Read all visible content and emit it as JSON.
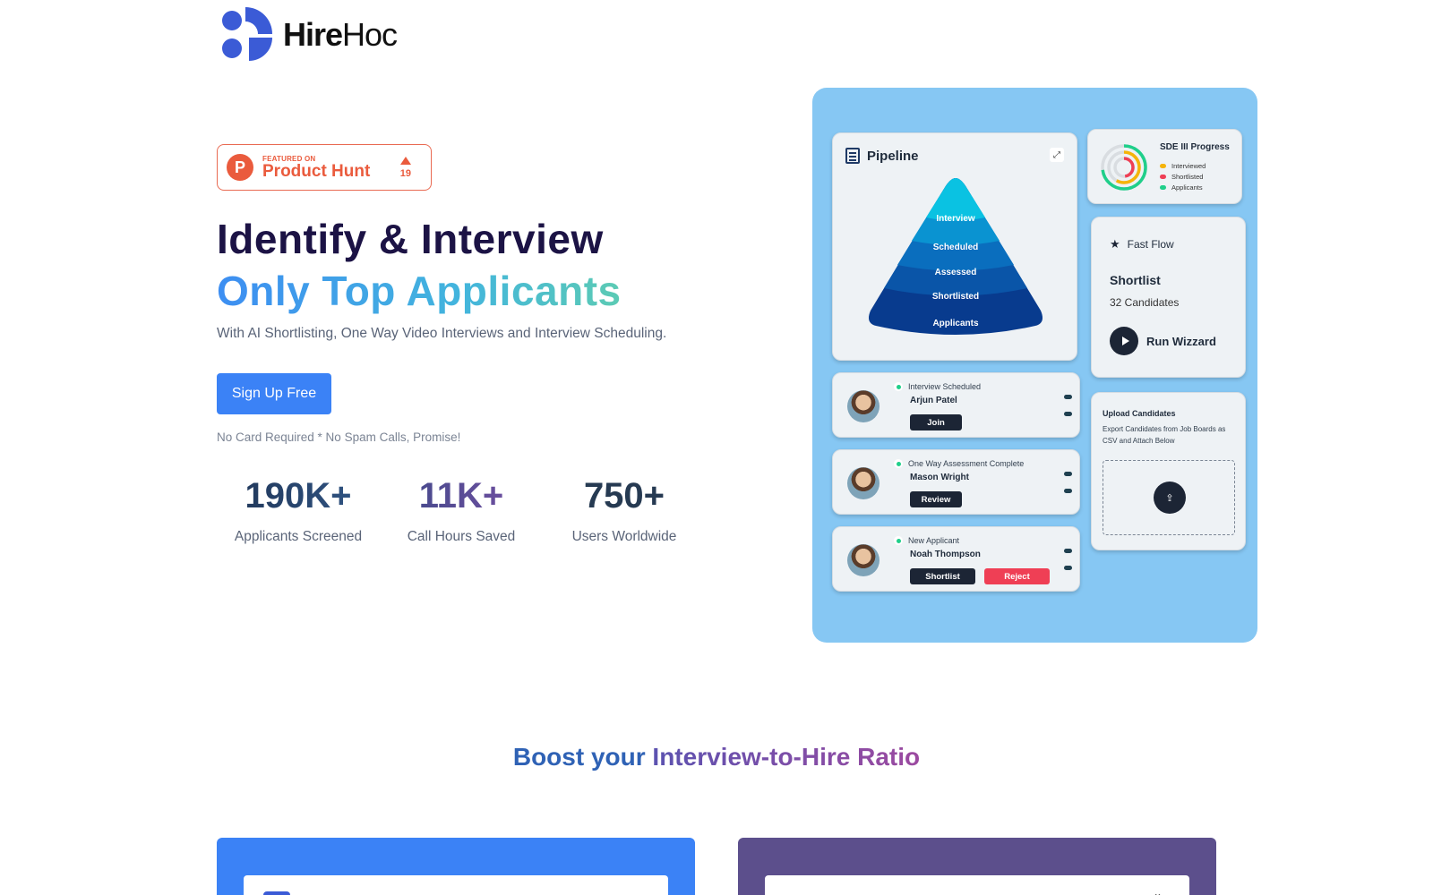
{
  "brand": {
    "name_bold": "Hire",
    "name_light": "Hoc",
    "colors": {
      "primary": "#3b5bd6",
      "signup": "#3b82f6",
      "product_hunt": "#ea5b3d"
    }
  },
  "product_hunt": {
    "letter": "P",
    "featured_on": "FEATURED ON",
    "name": "Product Hunt",
    "votes": "19"
  },
  "hero": {
    "title_line1": "Identify & Interview",
    "title_line2": "Only Top Applicants",
    "subtitle": "With AI Shortlisting, One Way Video Interviews and Interview Scheduling.",
    "cta": "Sign Up Free",
    "note": "No Card Required * No Spam Calls, Promise!"
  },
  "stats": [
    {
      "value": "190K+",
      "label": "Applicants Screened"
    },
    {
      "value": "11K+",
      "label": "Call Hours Saved"
    },
    {
      "value": "750+",
      "label": "Users Worldwide"
    }
  ],
  "pipeline": {
    "title": "Pipeline",
    "stages": [
      "Interview",
      "Scheduled",
      "Assessed",
      "Shortlisted",
      "Applicants"
    ]
  },
  "progress": {
    "title": "SDE III Progress",
    "legend": [
      {
        "label": "Interviewed",
        "color": "#f5b40a"
      },
      {
        "label": "Shortlisted",
        "color": "#ef3f55"
      },
      {
        "label": "Applicants",
        "color": "#1fcf8a"
      }
    ]
  },
  "fast_flow": {
    "label": "Fast Flow",
    "title": "Shortlist",
    "count": "32 Candidates",
    "run": "Run Wizzard"
  },
  "candidates": [
    {
      "status": "Interview Scheduled",
      "name": "Arjun Patel",
      "actions": [
        "Join"
      ]
    },
    {
      "status": "One Way Assessment Complete",
      "name": "Mason Wright",
      "actions": [
        "Review"
      ]
    },
    {
      "status": "New Applicant",
      "name": "Noah Thompson",
      "actions": [
        "Shortlist",
        "Reject"
      ]
    }
  ],
  "upload": {
    "title": "Upload Candidates",
    "description": "Export Candidates from Job Boards as CSV and Attach Below"
  },
  "boost": {
    "part1": "Boost your",
    "part2": "Interview-to-Hire Ratio"
  }
}
